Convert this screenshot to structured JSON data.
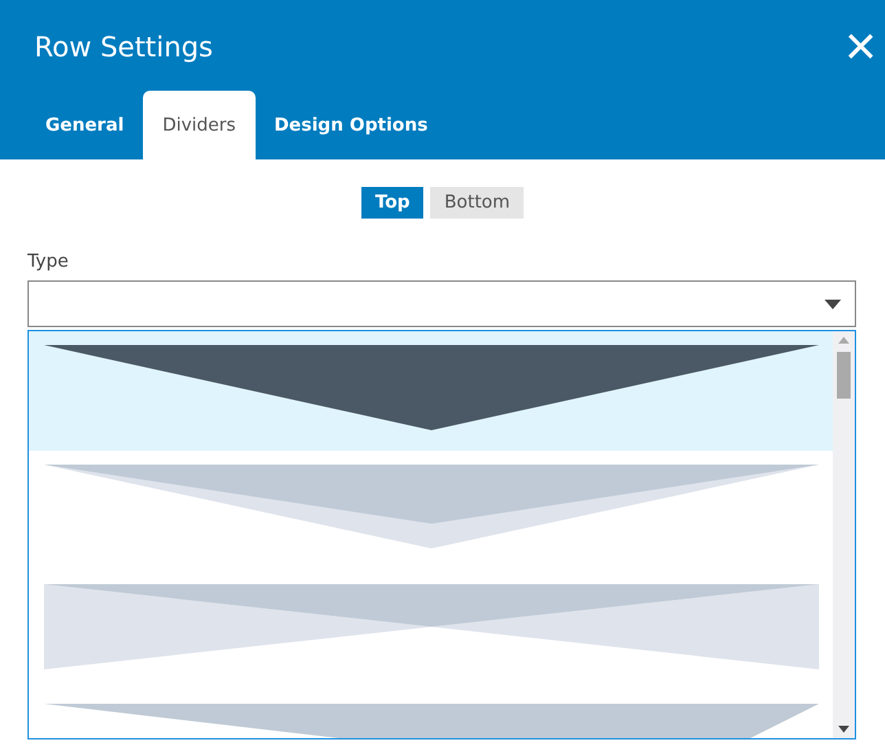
{
  "window": {
    "title": "Row Settings",
    "close": "×"
  },
  "tabs": [
    {
      "label": "General",
      "selected": false
    },
    {
      "label": "Dividers",
      "selected": true
    },
    {
      "label": "Design Options",
      "selected": false
    }
  ],
  "position_toggle": [
    {
      "label": "Top",
      "selected": true
    },
    {
      "label": "Bottom",
      "selected": false
    }
  ],
  "type_field": {
    "label": "Type",
    "options": [
      {
        "kind": "triangle",
        "selected": true
      },
      {
        "kind": "double-triangle",
        "selected": false
      },
      {
        "kind": "hourglass",
        "selected": false
      },
      {
        "kind": "slant",
        "selected": false
      }
    ]
  }
}
